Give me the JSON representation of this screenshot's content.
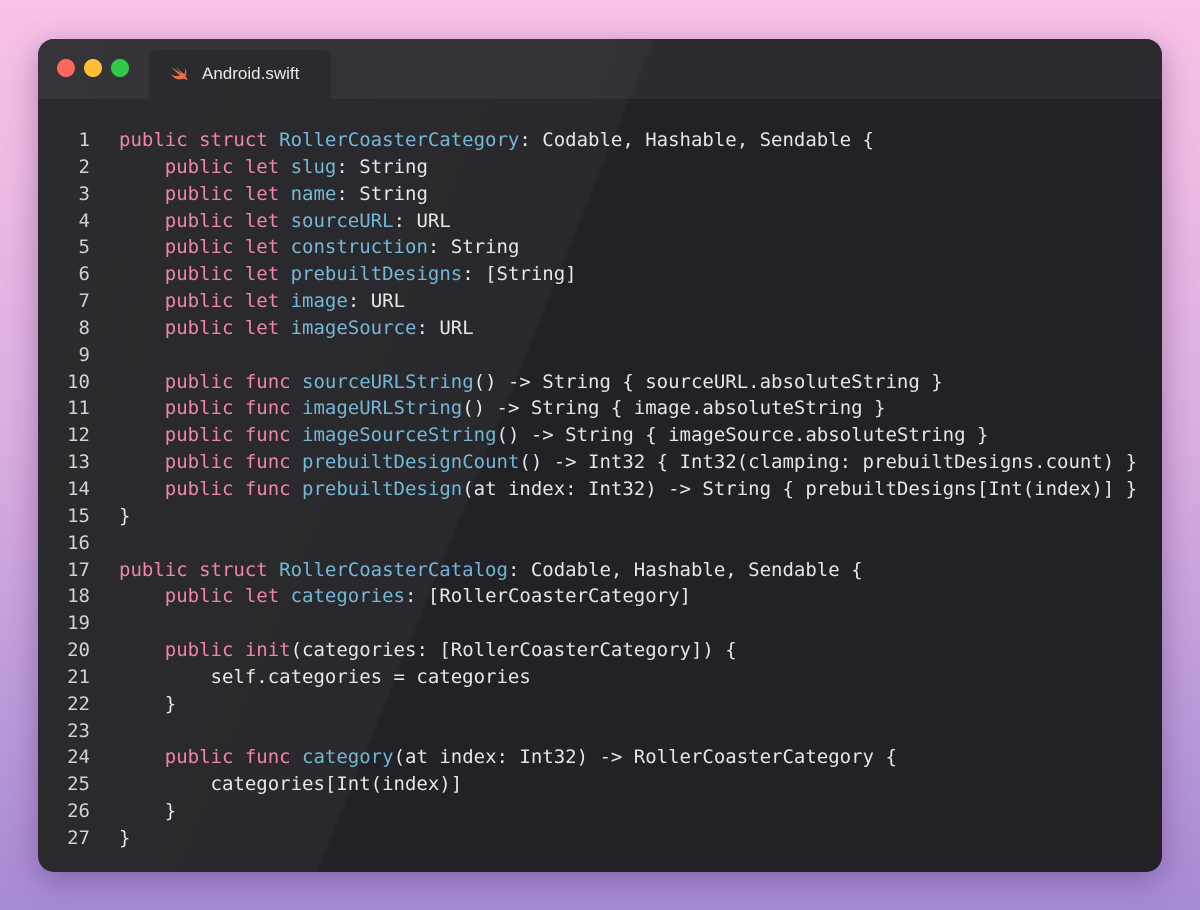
{
  "window": {
    "tab_title": "Android.swift",
    "tab_icon": "swift-icon",
    "traffic_lights": [
      "#ff5f57",
      "#febc2e",
      "#28c840"
    ]
  },
  "colors": {
    "keyword": "#f07fae",
    "identifier": "#6fb6d6",
    "plain": "#e6e6e9",
    "background": "#222226"
  },
  "code_lines": [
    {
      "n": "1",
      "tokens": [
        {
          "t": "kw",
          "s": "public struct "
        },
        {
          "t": "id",
          "s": "RollerCoasterCategory"
        },
        {
          "t": "pl",
          "s": ": Codable, Hashable, Sendable {"
        }
      ]
    },
    {
      "n": "2",
      "tokens": [
        {
          "t": "pl",
          "s": "    "
        },
        {
          "t": "kw",
          "s": "public let "
        },
        {
          "t": "id",
          "s": "slug"
        },
        {
          "t": "pl",
          "s": ": String"
        }
      ]
    },
    {
      "n": "3",
      "tokens": [
        {
          "t": "pl",
          "s": "    "
        },
        {
          "t": "kw",
          "s": "public let "
        },
        {
          "t": "id",
          "s": "name"
        },
        {
          "t": "pl",
          "s": ": String"
        }
      ]
    },
    {
      "n": "4",
      "tokens": [
        {
          "t": "pl",
          "s": "    "
        },
        {
          "t": "kw",
          "s": "public let "
        },
        {
          "t": "id",
          "s": "sourceURL"
        },
        {
          "t": "pl",
          "s": ": URL"
        }
      ]
    },
    {
      "n": "5",
      "tokens": [
        {
          "t": "pl",
          "s": "    "
        },
        {
          "t": "kw",
          "s": "public let "
        },
        {
          "t": "id",
          "s": "construction"
        },
        {
          "t": "pl",
          "s": ": String"
        }
      ]
    },
    {
      "n": "6",
      "tokens": [
        {
          "t": "pl",
          "s": "    "
        },
        {
          "t": "kw",
          "s": "public let "
        },
        {
          "t": "id",
          "s": "prebuiltDesigns"
        },
        {
          "t": "pl",
          "s": ": [String]"
        }
      ]
    },
    {
      "n": "7",
      "tokens": [
        {
          "t": "pl",
          "s": "    "
        },
        {
          "t": "kw",
          "s": "public let "
        },
        {
          "t": "id",
          "s": "image"
        },
        {
          "t": "pl",
          "s": ": URL"
        }
      ]
    },
    {
      "n": "8",
      "tokens": [
        {
          "t": "pl",
          "s": "    "
        },
        {
          "t": "kw",
          "s": "public let "
        },
        {
          "t": "id",
          "s": "imageSource"
        },
        {
          "t": "pl",
          "s": ": URL"
        }
      ]
    },
    {
      "n": "9",
      "tokens": []
    },
    {
      "n": "10",
      "tokens": [
        {
          "t": "pl",
          "s": "    "
        },
        {
          "t": "kw",
          "s": "public func "
        },
        {
          "t": "id",
          "s": "sourceURLString"
        },
        {
          "t": "pl",
          "s": "() -> String { sourceURL.absoluteString }"
        }
      ]
    },
    {
      "n": "11",
      "tokens": [
        {
          "t": "pl",
          "s": "    "
        },
        {
          "t": "kw",
          "s": "public func "
        },
        {
          "t": "id",
          "s": "imageURLString"
        },
        {
          "t": "pl",
          "s": "() -> String { image.absoluteString }"
        }
      ]
    },
    {
      "n": "12",
      "tokens": [
        {
          "t": "pl",
          "s": "    "
        },
        {
          "t": "kw",
          "s": "public func "
        },
        {
          "t": "id",
          "s": "imageSourceString"
        },
        {
          "t": "pl",
          "s": "() -> String { imageSource.absoluteString }"
        }
      ]
    },
    {
      "n": "13",
      "tokens": [
        {
          "t": "pl",
          "s": "    "
        },
        {
          "t": "kw",
          "s": "public func "
        },
        {
          "t": "id",
          "s": "prebuiltDesignCount"
        },
        {
          "t": "pl",
          "s": "() -> Int32 { Int32(clamping: prebuiltDesigns.count) }"
        }
      ]
    },
    {
      "n": "14",
      "tokens": [
        {
          "t": "pl",
          "s": "    "
        },
        {
          "t": "kw",
          "s": "public func "
        },
        {
          "t": "id",
          "s": "prebuiltDesign"
        },
        {
          "t": "pl",
          "s": "(at index: Int32) -> String { prebuiltDesigns[Int(index)] }"
        }
      ]
    },
    {
      "n": "15",
      "tokens": [
        {
          "t": "pl",
          "s": "}"
        }
      ]
    },
    {
      "n": "16",
      "tokens": []
    },
    {
      "n": "17",
      "tokens": [
        {
          "t": "kw",
          "s": "public struct "
        },
        {
          "t": "id",
          "s": "RollerCoasterCatalog"
        },
        {
          "t": "pl",
          "s": ": Codable, Hashable, Sendable {"
        }
      ]
    },
    {
      "n": "18",
      "tokens": [
        {
          "t": "pl",
          "s": "    "
        },
        {
          "t": "kw",
          "s": "public let "
        },
        {
          "t": "id",
          "s": "categories"
        },
        {
          "t": "pl",
          "s": ": [RollerCoasterCategory]"
        }
      ]
    },
    {
      "n": "19",
      "tokens": []
    },
    {
      "n": "20",
      "tokens": [
        {
          "t": "pl",
          "s": "    "
        },
        {
          "t": "kw",
          "s": "public init"
        },
        {
          "t": "pl",
          "s": "(categories: [RollerCoasterCategory]) {"
        }
      ]
    },
    {
      "n": "21",
      "tokens": [
        {
          "t": "pl",
          "s": "        self.categories = categories"
        }
      ]
    },
    {
      "n": "22",
      "tokens": [
        {
          "t": "pl",
          "s": "    }"
        }
      ]
    },
    {
      "n": "23",
      "tokens": []
    },
    {
      "n": "24",
      "tokens": [
        {
          "t": "pl",
          "s": "    "
        },
        {
          "t": "kw",
          "s": "public func "
        },
        {
          "t": "id",
          "s": "category"
        },
        {
          "t": "pl",
          "s": "(at index: Int32) -> RollerCoasterCategory {"
        }
      ]
    },
    {
      "n": "25",
      "tokens": [
        {
          "t": "pl",
          "s": "        categories[Int(index)]"
        }
      ]
    },
    {
      "n": "26",
      "tokens": [
        {
          "t": "pl",
          "s": "    }"
        }
      ]
    },
    {
      "n": "27",
      "tokens": [
        {
          "t": "pl",
          "s": "}"
        }
      ]
    }
  ]
}
